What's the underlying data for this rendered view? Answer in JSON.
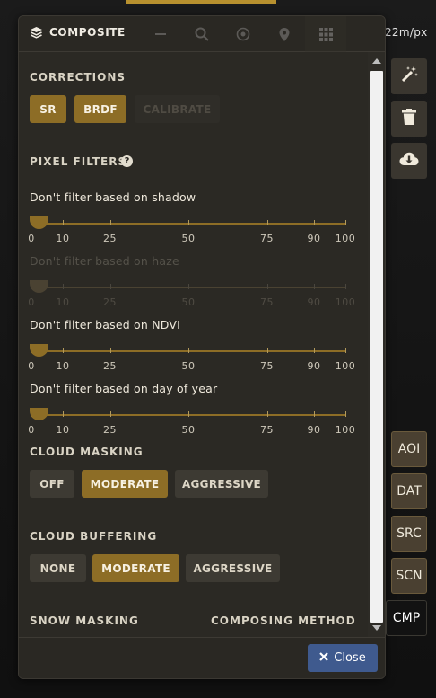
{
  "map": {
    "scale_readout": "22m/px"
  },
  "panel": {
    "title": "COMPOSITE",
    "title_icon": "layers-icon",
    "header_tools": [
      "minus-icon",
      "search-icon",
      "target-icon",
      "pin-icon",
      "grid-icon"
    ]
  },
  "corrections": {
    "title": "CORRECTIONS",
    "buttons": [
      {
        "label": "SR",
        "state": "on"
      },
      {
        "label": "BRDF",
        "state": "on"
      },
      {
        "label": "CALIBRATE",
        "state": "disabled"
      }
    ]
  },
  "pixel_filters": {
    "title": "PIXEL FILTERS",
    "help_glyph": "?",
    "tick_labels": [
      "0",
      "10",
      "25",
      "50",
      "75",
      "90",
      "100"
    ],
    "filters": [
      {
        "label": "Don't filter based on shadow",
        "value": 0,
        "enabled": true
      },
      {
        "label": "Don't filter based on haze",
        "value": 0,
        "enabled": false
      },
      {
        "label": "Don't filter based on NDVI",
        "value": 0,
        "enabled": true
      },
      {
        "label": "Don't filter based on day of year",
        "value": 0,
        "enabled": true
      }
    ]
  },
  "cloud_masking": {
    "title": "CLOUD MASKING",
    "options": [
      "OFF",
      "MODERATE",
      "AGGRESSIVE"
    ],
    "selected": "MODERATE"
  },
  "cloud_buffering": {
    "title": "CLOUD BUFFERING",
    "options": [
      "NONE",
      "MODERATE",
      "AGGRESSIVE"
    ],
    "selected": "MODERATE"
  },
  "snow_masking": {
    "title": "SNOW MASKING"
  },
  "composing_method": {
    "title": "COMPOSING METHOD"
  },
  "footer": {
    "close_label": "Close"
  },
  "side_tools": [
    "magic-wand-icon",
    "trash-icon",
    "cloud-download-icon"
  ],
  "side_tabs": [
    {
      "label": "AOI",
      "active": false
    },
    {
      "label": "DAT",
      "active": false
    },
    {
      "label": "SRC",
      "active": false
    },
    {
      "label": "SCN",
      "active": false
    },
    {
      "label": "CMP",
      "active": true
    }
  ],
  "colors": {
    "accent": "#8d6d26",
    "close_button": "#3f5a8e",
    "panel": "#2b2924"
  }
}
